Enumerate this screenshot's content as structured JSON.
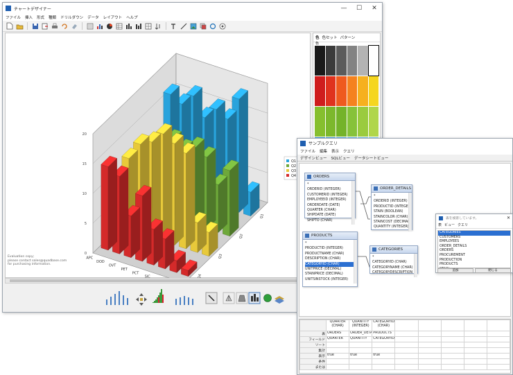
{
  "main_window": {
    "title": "チャートデザイナー",
    "controls": {
      "minimize": "—",
      "maximize": "☐",
      "close": "✕"
    },
    "menu": [
      "ファイル",
      "挿入",
      "形式",
      "種類",
      "ドリルダウン",
      "データ",
      "レイアウト",
      "ヘルプ"
    ],
    "palette": {
      "tabs": [
        "色",
        "色セット",
        "パターン"
      ],
      "sublabel": "色"
    },
    "note": [
      "Evaluation copy;",
      "please contact sales@quadbase.com",
      "for purchasing information."
    ],
    "colors": {
      "red": "#d42a2a",
      "yellow": "#e8c93a",
      "green": "#6ea83a",
      "blue": "#29a3dc"
    }
  },
  "chart_data": {
    "type": "bar3d",
    "categories": [
      "APC",
      "DOD",
      "OVT",
      "PET",
      "PCT",
      "SIC",
      "SID",
      "TRO"
    ],
    "legend": [
      "Q1",
      "Q2",
      "Q3",
      "Q4"
    ],
    "ylim": [
      0,
      20
    ],
    "yticks": [
      "0",
      "5",
      "10",
      "15",
      "20"
    ],
    "depth_ticks": [
      "Q1",
      "Q2",
      "Q3",
      "Q4"
    ],
    "series": [
      {
        "name": "Q4",
        "values": [
          14,
          13,
          7,
          11,
          6,
          5,
          2,
          1
        ]
      },
      {
        "name": "Q3",
        "values": [
          12,
          15,
          16,
          18,
          17,
          16,
          5,
          4
        ]
      },
      {
        "name": "Q2",
        "values": [
          9,
          11,
          13,
          12,
          13,
          12,
          8,
          11
        ]
      },
      {
        "name": "Q1",
        "values": [
          16,
          15,
          17,
          14,
          16,
          15,
          19,
          4
        ]
      }
    ],
    "legend_placement": "right"
  },
  "sample_window": {
    "title": "サンプルクエリ",
    "menu": [
      "ファイル",
      "編集",
      "表示",
      "クエリ"
    ],
    "view_tabs": [
      "デザインビュー",
      "SQLビュー",
      "データシートビュー"
    ],
    "tables": [
      {
        "name": "ORDERS",
        "fields": [
          "*",
          "ORDERID (INTEGER)",
          "CUSTOMERID (INTEGER)",
          "EMPLOYEEID (INTEGER)",
          "ORDERDATE (DATE)",
          "QUARTER (CHAR)",
          "SHIPDATE (DATE)",
          "SHIPTO (CHAR)"
        ],
        "selected": -1
      },
      {
        "name": "ORDER_DETAILS",
        "fields": [
          "*",
          "ORDERID (INTEGER)",
          "PRODUCTID (INTEGER)",
          "STAIN (BOOLEAN)",
          "STAINCOLOR (CHAR)",
          "STAINCOST (DECIMAL)",
          "QUANTITY (INTEGER)"
        ],
        "selected": -1
      },
      {
        "name": "PRODUCTS",
        "fields": [
          "*",
          "PRODUCTID (INTEGER)",
          "PRODUCTNAME (CHAR)",
          "DESCRIPTION (CHAR)",
          "CATEGORYID (CHAR)",
          "UNITPRICE (DECIMAL)",
          "STAINPRICE (DECIMAL)",
          "UNITSINSTOCK (INTEGER)"
        ],
        "selected": 4
      },
      {
        "name": "CATEGORIES",
        "fields": [
          "*",
          "CATEGORYID (CHAR)",
          "CATEGORYNAME (CHAR)",
          "CATEGORYDESCRIPTION (CHAR)"
        ],
        "selected": -1
      }
    ],
    "grid": {
      "columns": [
        {
          "head": [
            "QUARTER",
            "(CHAR)"
          ],
          "table": "ORDERS",
          "field": "QUARTER",
          "show": "true"
        },
        {
          "head": [
            "QUANTITY",
            "(INTEGER)"
          ],
          "table": "ORDER_DETAILS",
          "field": "QUANTITY",
          "show": "true"
        },
        {
          "head": [
            "CATEGORYID",
            "(CHAR)"
          ],
          "table": "PRODUCTS",
          "field": "CATEGORYID",
          "show": "true"
        }
      ],
      "row_labels": [
        "表",
        "フィールド",
        "ソート",
        "集計",
        "表示",
        "条件",
        "または"
      ]
    }
  },
  "dialog": {
    "search_placeholder": "表を検索しています。",
    "tabs": [
      "表",
      "ビュー",
      "クエリ"
    ],
    "items": [
      "CATEGORIES",
      "CUSTOMERS",
      "EMPLOYEES",
      "ORDER_DETAILS",
      "ORDERS",
      "PROCUREMENT",
      "PRODUCTION",
      "PRODUCTS",
      "STAIN"
    ],
    "selected_index": 0,
    "buttons": [
      "追加",
      "閉じる"
    ]
  }
}
